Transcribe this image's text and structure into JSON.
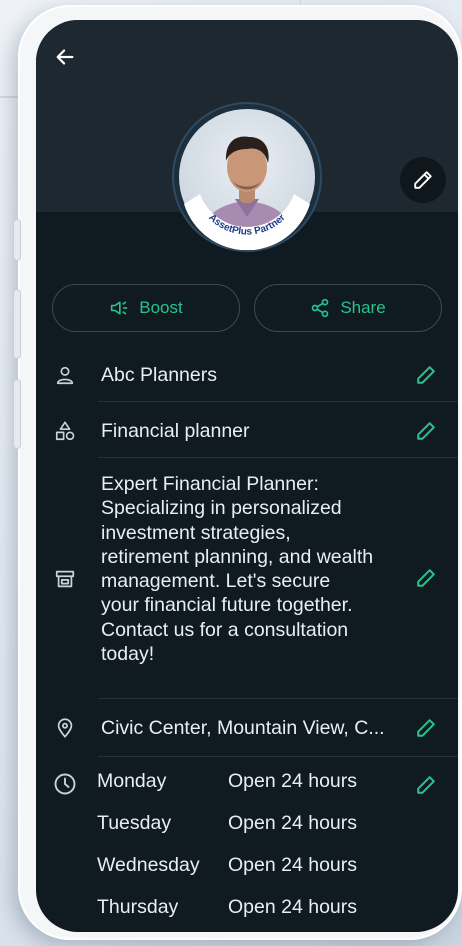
{
  "profile": {
    "avatar_badge_text": "AssetPlus Partner"
  },
  "actions": {
    "boost_label": "Boost",
    "share_label": "Share"
  },
  "details": {
    "business_name": "Abc Planners",
    "category": "Financial planner",
    "description_lines": [
      "Expert Financial Planner:",
      "Specializing in personalized",
      "investment strategies,",
      "retirement planning, and wealth",
      "management. Let's secure",
      "your financial future together.",
      "Contact us for a consultation",
      "today!"
    ],
    "address": "Civic Center, Mountain View, C..."
  },
  "hours": [
    {
      "day": "Monday",
      "time": "Open 24 hours"
    },
    {
      "day": "Tuesday",
      "time": "Open 24 hours"
    },
    {
      "day": "Wednesday",
      "time": "Open 24 hours"
    },
    {
      "day": "Thursday",
      "time": "Open 24 hours"
    }
  ],
  "icons": {
    "back": "arrow-left-icon",
    "edit": "pencil-icon",
    "boost": "megaphone-icon",
    "share": "share-icon",
    "person": "person-icon",
    "category": "shapes-icon",
    "store": "store-icon",
    "location": "location-pin-icon",
    "clock": "clock-icon"
  },
  "colors": {
    "accent": "#29c28e",
    "background": "#101a21",
    "header": "#1d2830",
    "text": "#e9eef2"
  }
}
